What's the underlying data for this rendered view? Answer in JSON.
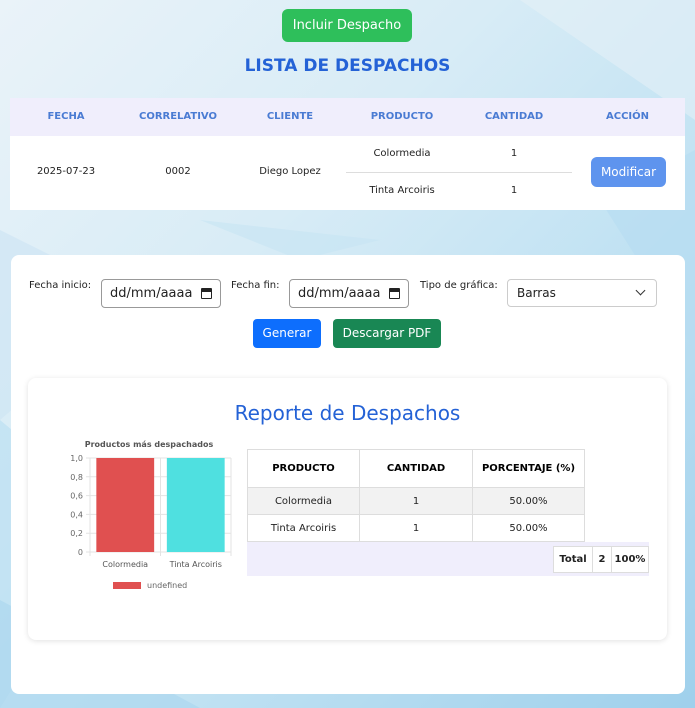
{
  "actions": {
    "incluir_label": "Incluir Despacho"
  },
  "list": {
    "title": "LISTA DE DESPACHOS",
    "headers": [
      "FECHA",
      "CORRELATIVO",
      "CLIENTE",
      "PRODUCTO",
      "CANTIDAD",
      "ACCIÓN"
    ],
    "rows": [
      {
        "fecha": "2025-07-23",
        "correlativo": "0002",
        "cliente": "Diego Lopez",
        "productos": [
          {
            "producto": "Colormedia",
            "cantidad": "1"
          },
          {
            "producto": "Tinta Arcoiris",
            "cantidad": "1"
          }
        ],
        "action_label": "Modificar"
      }
    ]
  },
  "filters": {
    "fecha_inicio_label": "Fecha inicio:",
    "fecha_inicio_value": "dd/mm/aaaa",
    "fecha_fin_label": "Fecha fin:",
    "fecha_fin_value": "dd/mm/aaaa",
    "tipo_label": "Tipo de gráfica:",
    "tipo_value": "Barras",
    "generar_label": "Generar",
    "pdf_label": "Descargar PDF"
  },
  "report": {
    "title": "Reporte de Despachos",
    "table_headers": [
      "PRODUCTO",
      "CANTIDAD",
      "PORCENTAJE (%)"
    ],
    "table_rows": [
      {
        "producto": "Colormedia",
        "cantidad": "1",
        "porcentaje": "50.00%"
      },
      {
        "producto": "Tinta Arcoiris",
        "cantidad": "1",
        "porcentaje": "50.00%"
      }
    ],
    "total_label": "Total",
    "total_cantidad": "2",
    "total_porcentaje": "100%"
  },
  "chart_data": {
    "type": "bar",
    "title": "Productos más despachados",
    "categories": [
      "Colormedia",
      "Tinta Arcoiris"
    ],
    "series": [
      {
        "name": "undefined",
        "values": [
          1,
          1
        ]
      }
    ],
    "bar_colors": [
      "#e05050",
      "#4fe0e0"
    ],
    "ylim": [
      0,
      1
    ],
    "yticks": [
      "0",
      "0,2",
      "0,4",
      "0,6",
      "0,8",
      "1,0"
    ],
    "legend": "bottom",
    "grid": true
  },
  "colors": {
    "accent_blue": "#2462d6",
    "green_button": "#2ebf5b",
    "modify_button": "#5e94ee",
    "primary": "#0d6efd",
    "success": "#198754"
  }
}
